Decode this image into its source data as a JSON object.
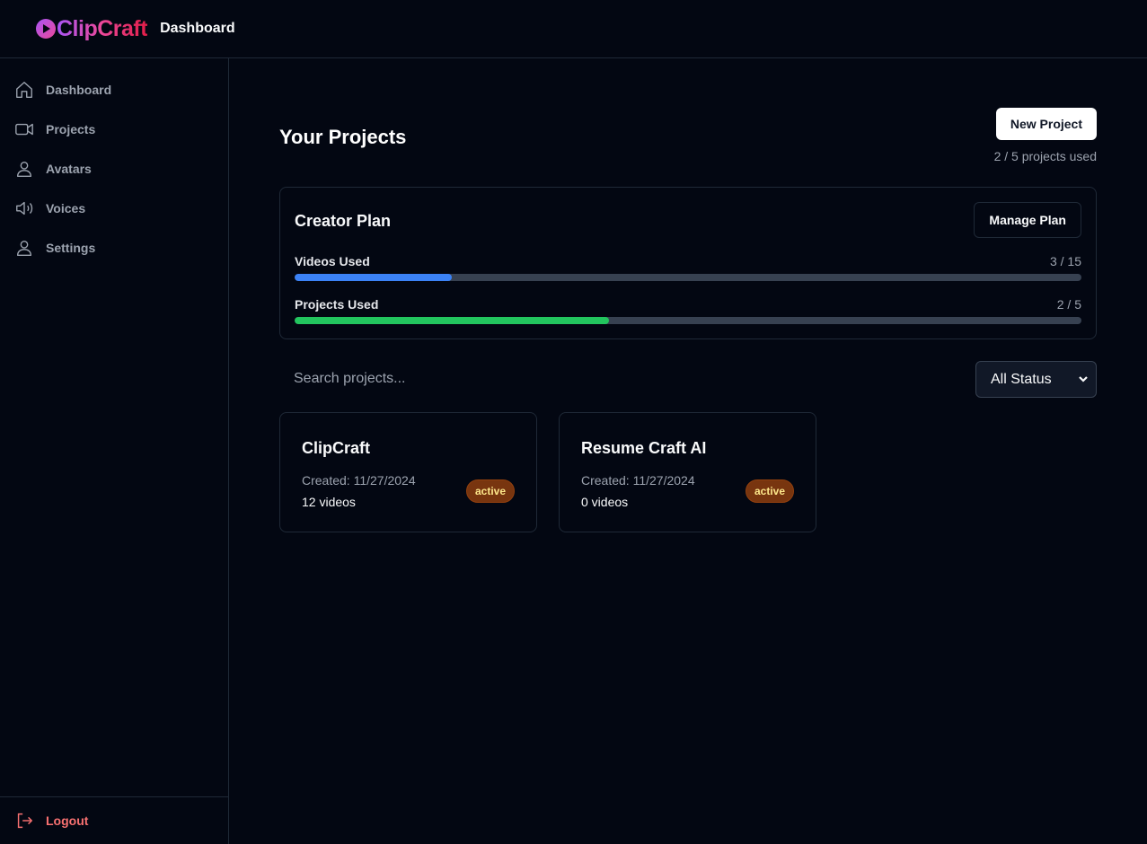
{
  "header": {
    "brand": "ClipCraft",
    "title": "Dashboard"
  },
  "sidebar": {
    "items": [
      {
        "label": "Dashboard",
        "icon": "home-icon"
      },
      {
        "label": "Projects",
        "icon": "video-icon"
      },
      {
        "label": "Avatars",
        "icon": "user-icon"
      },
      {
        "label": "Voices",
        "icon": "speaker-icon"
      },
      {
        "label": "Settings",
        "icon": "user-icon"
      }
    ],
    "logout_label": "Logout"
  },
  "main": {
    "title": "Your Projects",
    "new_project_label": "New Project",
    "usage_text": "2 / 5 projects used",
    "plan": {
      "name": "Creator Plan",
      "manage_label": "Manage Plan",
      "meters": [
        {
          "label": "Videos Used",
          "value": "3 / 15",
          "fraction": 0.2,
          "color": "#3b82f6"
        },
        {
          "label": "Projects Used",
          "value": "2 / 5",
          "fraction": 0.4,
          "color": "#22c55e"
        }
      ]
    },
    "search": {
      "placeholder": "Search projects..."
    },
    "status_filter": {
      "selected": "All Status"
    },
    "projects": [
      {
        "name": "ClipCraft",
        "created": "Created: 11/27/2024",
        "videos": "12 videos",
        "status": "active"
      },
      {
        "name": "Resume Craft AI",
        "created": "Created: 11/27/2024",
        "videos": "0 videos",
        "status": "active"
      }
    ]
  },
  "colors": {
    "accent_purple": "#a855f7",
    "accent_pink": "#ec4899",
    "logout": "#f87171",
    "badge_bg": "#78350f"
  }
}
